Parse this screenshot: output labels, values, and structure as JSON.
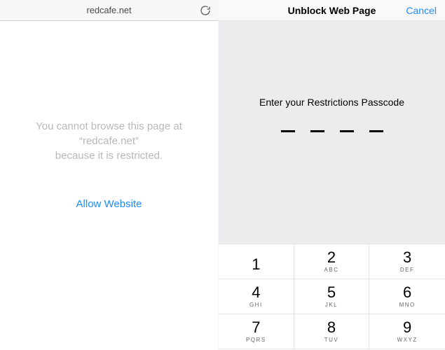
{
  "left": {
    "url": "redcafe.net",
    "message_l1": "You cannot browse this page at",
    "message_l2": "“redcafe.net”",
    "message_l3": "because it is restricted.",
    "allow_label": "Allow Website",
    "reload_icon": "reload-icon"
  },
  "right": {
    "title": "Unblock Web Page",
    "cancel": "Cancel",
    "prompt": "Enter your Restrictions Passcode",
    "passcode_length": 4,
    "keys": [
      {
        "digit": "1",
        "letters": ""
      },
      {
        "digit": "2",
        "letters": "ABC"
      },
      {
        "digit": "3",
        "letters": "DEF"
      },
      {
        "digit": "4",
        "letters": "GHI"
      },
      {
        "digit": "5",
        "letters": "JKL"
      },
      {
        "digit": "6",
        "letters": "MNO"
      },
      {
        "digit": "7",
        "letters": "PQRS"
      },
      {
        "digit": "8",
        "letters": "TUV"
      },
      {
        "digit": "9",
        "letters": "WXYZ"
      }
    ]
  }
}
